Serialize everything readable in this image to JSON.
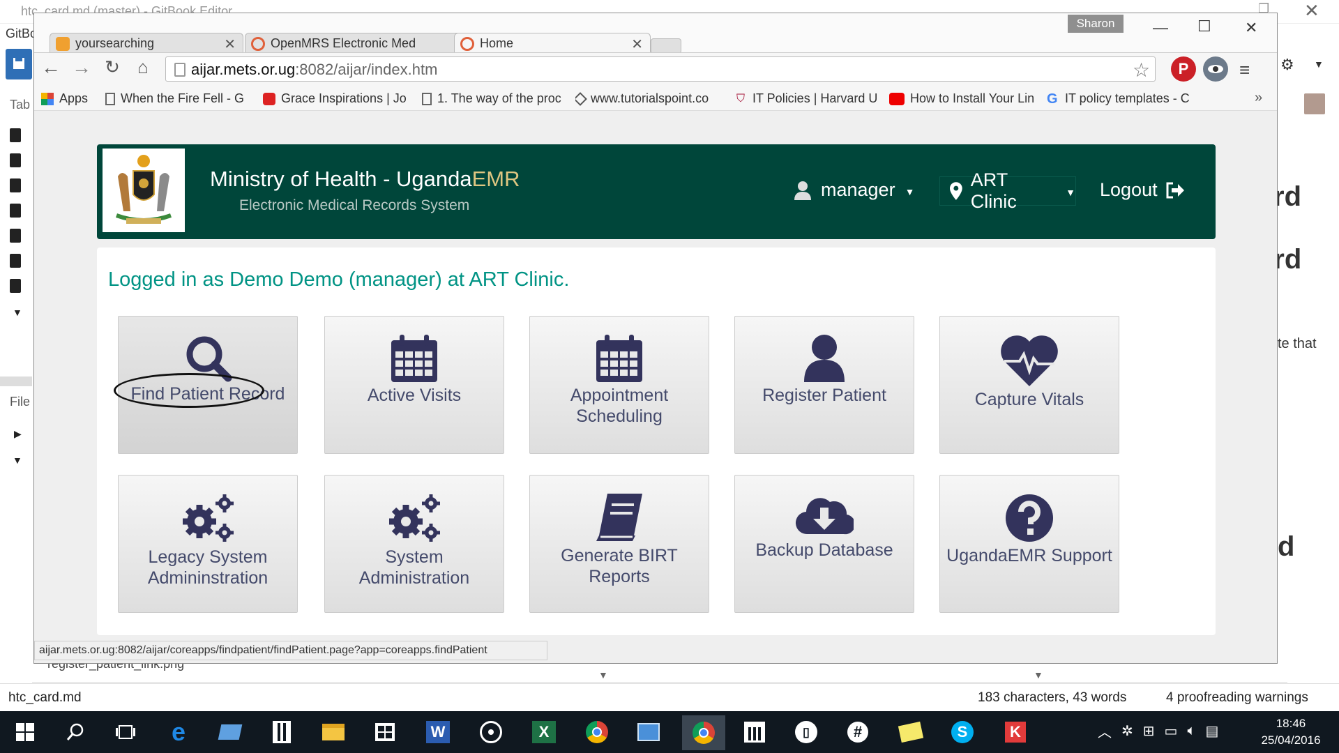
{
  "background_editor": {
    "window_title": "htc_card.md (master) - GitBook Editor",
    "app_name": "GitBo",
    "tab_label": "Tab",
    "files_label": "File",
    "right_fragments": [
      "rd",
      "ard",
      "te that",
      "d"
    ],
    "bottom_file": "register_patient_link.png",
    "status_file": "htc_card.md",
    "status_count": "183 characters, 43 words",
    "status_proof": "4 proofreading warnings"
  },
  "browser": {
    "profile_name": "Sharon",
    "tabs": [
      {
        "label": "yoursearching",
        "icon_color": "#f0a030"
      },
      {
        "label": "OpenMRS Electronic Med",
        "icon_color": "#e0603a"
      },
      {
        "label": "Home",
        "icon_color": "#e0603a"
      }
    ],
    "url_host": "aijar.mets.or.ug",
    "url_path": ":8082/aijar/index.htm",
    "bookmarks": [
      "Apps",
      "When the Fire Fell - G",
      "Grace Inspirations | Jo",
      "1. The way of the proc",
      "www.tutorialspoint.co",
      "IT Policies | Harvard U",
      "How to Install Your Lin",
      "IT policy templates - C"
    ],
    "status_url": "aijar.mets.or.ug:8082/aijar/coreapps/findpatient/findPatient.page?app=coreapps.findPatient"
  },
  "header": {
    "title_main": "Ministry of Health - Uganda",
    "title_accent": "EMR",
    "subtitle": "Electronic Medical Records System",
    "user": "manager",
    "location": "ART Clinic",
    "logout": "Logout"
  },
  "main": {
    "logged_in_message": "Logged in as Demo Demo (manager) at ART Clinic.",
    "tiles": [
      {
        "label": "Find Patient Record",
        "icon": "search-icon"
      },
      {
        "label": "Active Visits",
        "icon": "calendar-icon"
      },
      {
        "label": "Appointment Scheduling",
        "icon": "calendar-icon"
      },
      {
        "label": "Register Patient",
        "icon": "user-icon"
      },
      {
        "label": "Capture Vitals",
        "icon": "heartbeat-icon"
      },
      {
        "label": "Legacy System Admininstration",
        "icon": "gears-icon"
      },
      {
        "label": "System Administration",
        "icon": "gears-icon"
      },
      {
        "label": "Generate BIRT Reports",
        "icon": "book-icon"
      },
      {
        "label": "Backup Database",
        "icon": "cloud-download-icon"
      },
      {
        "label": "UgandaEMR Support",
        "icon": "question-icon"
      }
    ]
  },
  "taskbar": {
    "time": "18:46",
    "date": "25/04/2016"
  },
  "colors": {
    "header_bg": "#00463a",
    "accent": "#009384",
    "icon_color": "#33335c"
  }
}
